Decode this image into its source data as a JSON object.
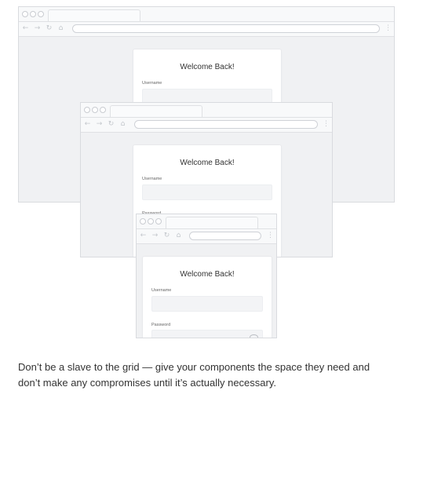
{
  "windows": [
    {
      "id": "back",
      "login": {
        "title": "Welcome Back!",
        "username_label": "Username",
        "password_label": ""
      }
    },
    {
      "id": "middle",
      "login": {
        "title": "Welcome Back!",
        "username_label": "Username",
        "password_label": "Password"
      }
    },
    {
      "id": "front",
      "login": {
        "title": "Welcome Back!",
        "username_label": "Username",
        "password_label": "Password"
      }
    }
  ],
  "browser_ui": {
    "back_glyph": "←",
    "forward_glyph": "→",
    "reload_glyph": "↻",
    "home_glyph": "⌂",
    "menu_glyph": "⋮"
  },
  "caption": "Don’t be a slave to the grid — give your components the space they need and don’t make any compromises until it’s actually necessary."
}
